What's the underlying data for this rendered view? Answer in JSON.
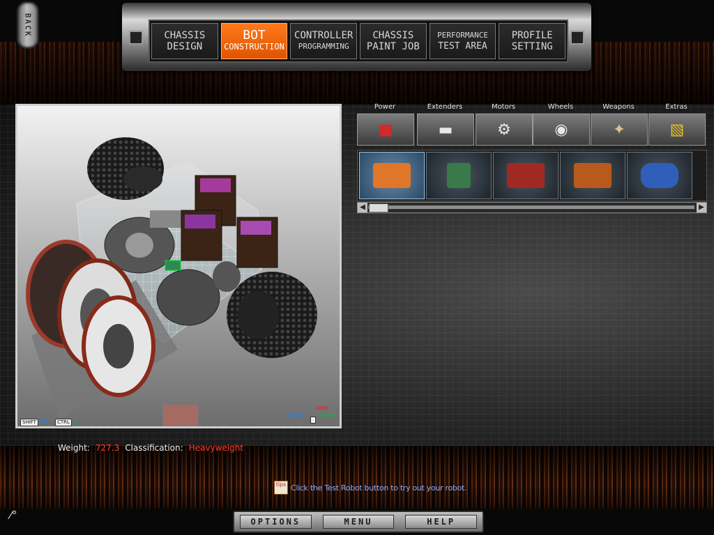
{
  "back": {
    "label": "BACK"
  },
  "tabs": [
    {
      "line1": "CHASSIS",
      "line2": "DESIGN",
      "active": false
    },
    {
      "line1": "BOT",
      "line2": "CONSTRUCTION",
      "active": true
    },
    {
      "line1": "CONTROLLER",
      "line2": "PROGRAMMING",
      "active": false
    },
    {
      "line1": "CHASSIS",
      "line2": "PAINT JOB",
      "active": false
    },
    {
      "line1": "PERFORMANCE",
      "line2": "TEST AREA",
      "active": false
    },
    {
      "line1": "PROFILE",
      "line2": "SETTING",
      "active": false
    }
  ],
  "categories": [
    {
      "label": "Power",
      "icon": "battery-icon"
    },
    {
      "label": "Extenders",
      "icon": "extender-bar-icon"
    },
    {
      "label": "Motors",
      "icon": "motor-icon"
    },
    {
      "label": "Wheels",
      "icon": "wheel-icon"
    },
    {
      "label": "Weapons",
      "icon": "weapon-icon"
    },
    {
      "label": "Extras",
      "icon": "hazard-stripe-icon"
    }
  ],
  "parts": [
    {
      "name": "orange-controller-board",
      "color": "#e0762a",
      "selected": true
    },
    {
      "name": "green-circuit-board",
      "color": "#3a7a4a",
      "selected": false
    },
    {
      "name": "red-battery-pack",
      "color": "#a02a22",
      "selected": false
    },
    {
      "name": "battery-pair",
      "color": "#b85a1c",
      "selected": false
    },
    {
      "name": "blue-puma-battery",
      "color": "#2f5fb8",
      "selected": false
    }
  ],
  "viewport_controls": {
    "shift": "SHIFT",
    "ctrl": "CTRL",
    "action": "ACTION",
    "zoom": "ZOOM",
    "rotate": "ROTATE"
  },
  "stats": {
    "weight_label": "Weight:",
    "weight_value": "727.3",
    "class_label": "Classification:",
    "class_value": "Heavyweight"
  },
  "tip": {
    "icon_text": "tips",
    "text": "Click the Test Robot button to try out your robot."
  },
  "bottom_nav": {
    "options": "OPTIONS",
    "menu": "MENU",
    "help": "HELP"
  },
  "colors": {
    "accent": "#e05300",
    "value_red": "#ff3b2f",
    "tip_blue": "#8fa9ff"
  }
}
